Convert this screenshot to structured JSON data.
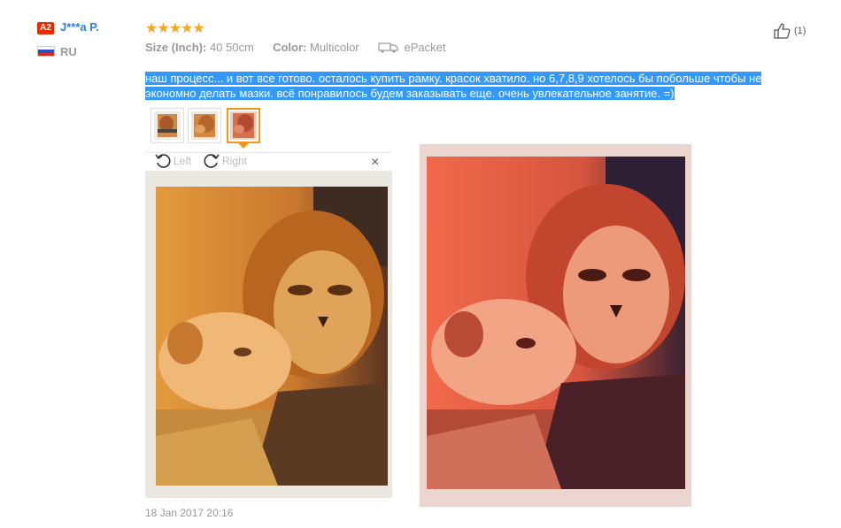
{
  "reviewer": {
    "level_badge": "A2",
    "name": "J***a P.",
    "country": "RU",
    "flag_icon": "russia-flag-icon"
  },
  "rating": {
    "stars": 5,
    "max": 5,
    "display": "★★★★★",
    "color": "#f5a623"
  },
  "attributes": [
    {
      "key": "Size (Inch):",
      "value": "40 50cm"
    },
    {
      "key": "Color:",
      "value": "Multicolor"
    }
  ],
  "shipping": {
    "icon": "truck-icon",
    "value": "ePacket"
  },
  "helpful": {
    "icon": "thumbs-up-icon",
    "count": "(1)"
  },
  "feedback_text": "наш процесс... и вот все готово. осталось купить рамку. красок хватило. но 6,7,8,9 хотелось бы побольше чтобы не экономно делать мазки. всё понравилось будем заказывать еще. очень увлекательное занятие. =)",
  "thumbnails": [
    {
      "label": "photo-1",
      "active": false
    },
    {
      "label": "photo-2",
      "active": false
    },
    {
      "label": "photo-3",
      "active": true
    }
  ],
  "viewer": {
    "rotate_left": "Left",
    "rotate_right": "Right",
    "close": "×"
  },
  "date": "18 Jan 2017 20:16",
  "colors": {
    "accent": "#f29718",
    "link": "#2f7fd8",
    "selection": "#3399ff",
    "badge": "#e62e04"
  }
}
